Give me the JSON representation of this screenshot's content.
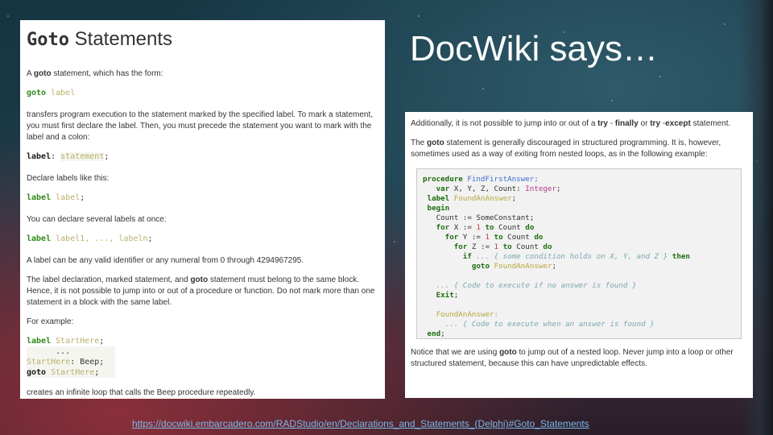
{
  "left": {
    "title_kw": "Goto",
    "title_rest": " Statements",
    "p1_pre": "A ",
    "p1_bold": "goto",
    "p1_post": " statement, which has the form:",
    "code1_kw": "goto",
    "code1_lbl": " label",
    "p2": "transfers program execution to the statement marked by the specified label. To mark a statement, you must first declare the label. Then, you must precede the statement you want to mark with the label and a colon:",
    "code2_a": "label",
    "code2_b": ": ",
    "code2_c": "statement",
    "code2_d": ";",
    "p3": "Declare labels like this:",
    "code3_kw": "label",
    "code3_lbl": " label",
    "code3_end": ";",
    "p4": "You can declare several labels at once:",
    "code4_kw": "label",
    "code4_lbl": " label1, ..., labeln",
    "code4_end": ";",
    "p5": "A label can be any valid identifier or any numeral from 0 through 4294967295.",
    "p6_pre": "The label declaration, marked statement, and ",
    "p6_bold": "goto",
    "p6_post": " statement must belong to the same block. Hence, it is not possible to jump into or out of a procedure or function. Do not mark more than one statement in a block with the same label.",
    "p7": "For example:",
    "ex_l1_kw": "label",
    "ex_l1_lbl": " StartHere",
    "ex_l1_end": ";",
    "ex_l2": "      ...",
    "ex_l3_lbl": " StartHere",
    "ex_l3_rest": ": Beep;",
    "ex_l4_kw": " goto",
    "ex_l4_lbl": " StartHere",
    "ex_l4_end": ";",
    "p8": "creates an infinite loop that calls the Beep procedure repeatedly."
  },
  "heading": "DocWiki says…",
  "right": {
    "p1_a": "Additionally, it is not possible to jump into or out of a ",
    "p1_b": "try",
    "p1_c": " - ",
    "p1_d": "finally",
    "p1_e": " or ",
    "p1_f": "try",
    "p1_g": " -",
    "p1_h": "except",
    "p1_i": " statement.",
    "p2_a": "The ",
    "p2_b": "goto",
    "p2_c": " statement is generally discouraged in structured programming. It is, however, sometimes used as a way of exiting from nested loops, as in the following example:",
    "code": {
      "l1_k": "procedure",
      "l1_f": " FindFirstAnswer;",
      "l2_k": "   var",
      "l2_p": " X, Y, Z, Count: ",
      "l2_t": "Integer",
      "l2_e": ";",
      "l3_k": " label",
      "l3_l": " FoundAnAnswer",
      "l3_e": ";",
      "l4_k": " begin",
      "l5": "   Count := SomeConstant;",
      "l6_k1": "   for",
      "l6_p1": " X := ",
      "l6_n": "1",
      "l6_k2": " to",
      "l6_p2": " Count ",
      "l6_k3": "do",
      "l7_k1": "     for",
      "l7_p1": " Y := ",
      "l7_n": "1",
      "l7_k2": " to",
      "l7_p2": " Count ",
      "l7_k3": "do",
      "l8_k1": "       for",
      "l8_p1": " Z := ",
      "l8_n": "1",
      "l8_k2": " to",
      "l8_p2": " Count ",
      "l8_k3": "do",
      "l9_k": "         if",
      "l9_c": " ... { some condition holds on X, Y, and Z }",
      "l9_k2": " then",
      "l10_k": "           goto",
      "l10_l": " FoundAnAnswer",
      "l10_e": ";",
      "l11": " ",
      "l12": "   ... { Code to execute if no answer is found }",
      "l13_k": "   Exit",
      "l13_e": ";",
      "l14": " ",
      "l15": "   FoundAnAnswer:",
      "l16": "     ... { Code to execute when an answer is found }",
      "l17_k": " end",
      "l17_e": ";"
    },
    "p3_a": "Notice that we are using ",
    "p3_b": "goto",
    "p3_c": " to jump out of a nested loop. Never jump into a loop or other structured statement, because this can have unpredictable effects."
  },
  "link_text": "https://docwiki.embarcadero.com/RADStudio/en/Declarations_and_Statements_(Delphi)#Goto_Statements",
  "colors": {
    "keyword": "#2f8a1a",
    "label": "#b9b06a",
    "link": "#7ab8e8"
  }
}
